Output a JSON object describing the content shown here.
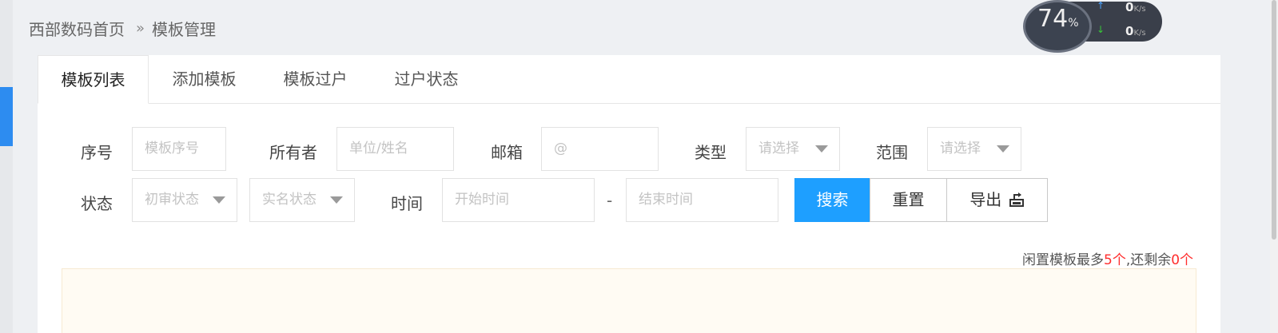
{
  "breadcrumb": {
    "home": "西部数码首页",
    "separator": "»",
    "current": "模板管理"
  },
  "monitor": {
    "percent": "74",
    "percent_unit": "%",
    "upload": "0",
    "download": "0",
    "unit": "K/s"
  },
  "tabs": [
    "模板列表",
    "添加模板",
    "模板过户",
    "过户状态"
  ],
  "filters": {
    "index_label": "序号",
    "index_placeholder": "模板序号",
    "owner_label": "所有者",
    "owner_placeholder": "单位/姓名",
    "email_label": "邮箱",
    "email_placeholder": "@",
    "type_label": "类型",
    "type_value": "请选择",
    "scope_label": "范围",
    "scope_value": "请选择",
    "status_label": "状态",
    "review_value": "初审状态",
    "realname_value": "实名状态",
    "time_label": "时间",
    "start_placeholder": "开始时间",
    "dash": "-",
    "end_placeholder": "结束时间"
  },
  "actions": {
    "search": "搜索",
    "reset": "重置",
    "export": "导出"
  },
  "notice": {
    "prefix": "闲置模板最多",
    "max": "5个",
    "middle": ",还剩余",
    "remain": "0个"
  }
}
